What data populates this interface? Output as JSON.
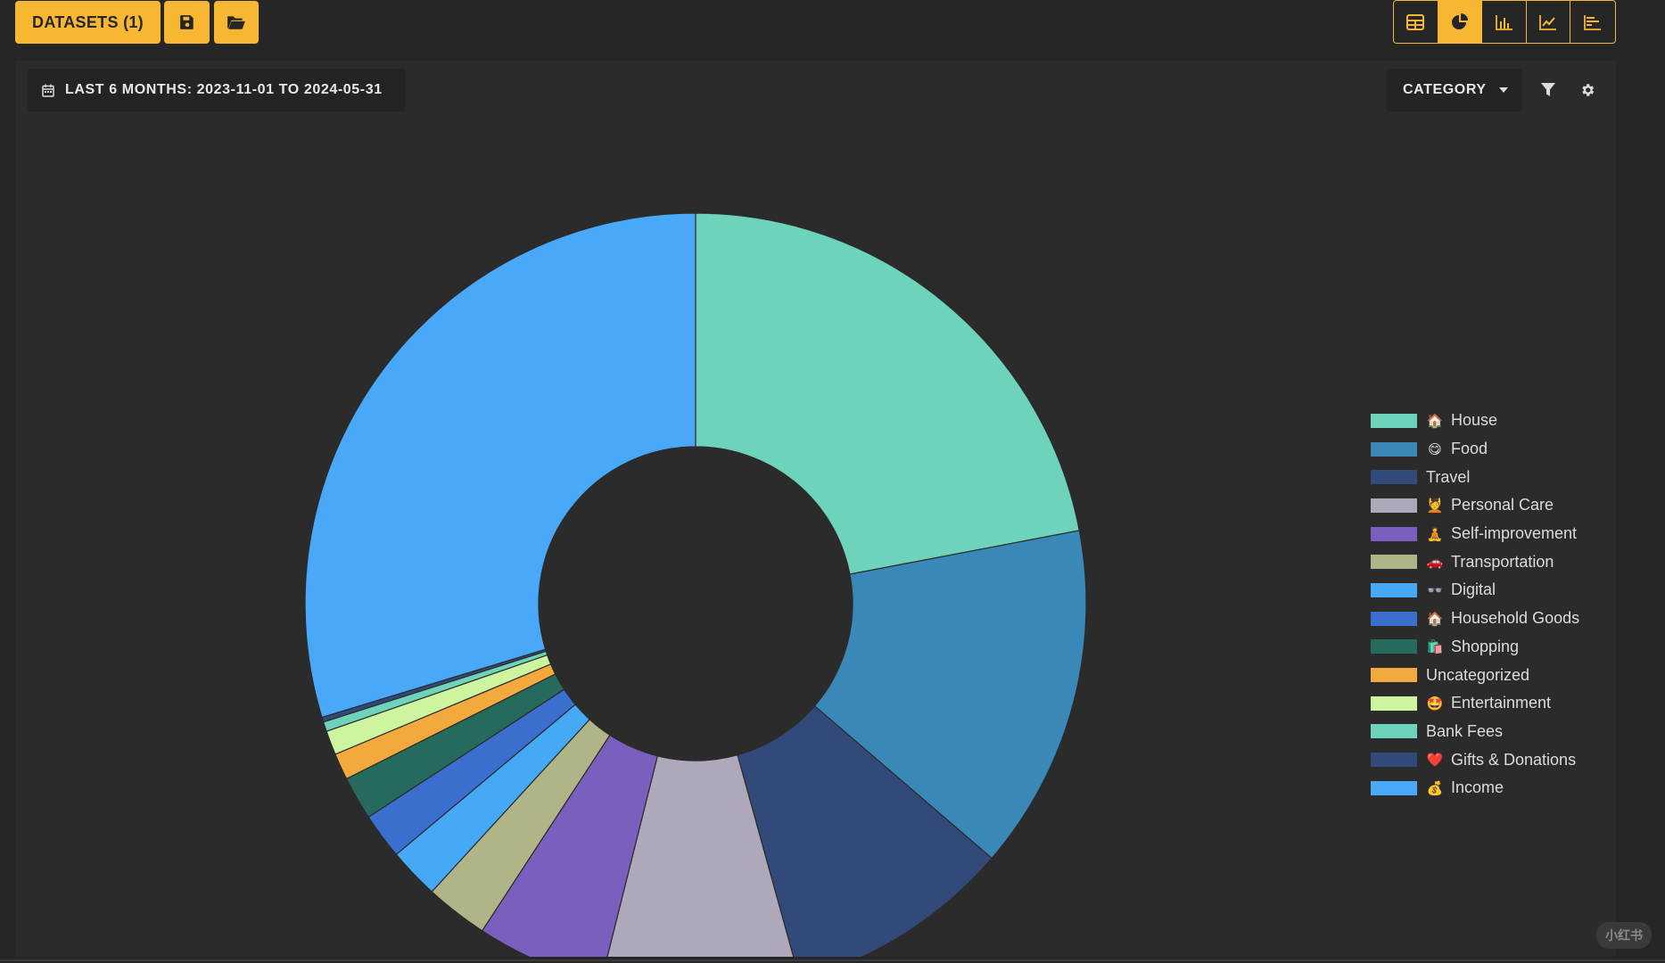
{
  "toolbar": {
    "datasets_label": "DATASETS (1)",
    "save_icon": "save-icon",
    "open_icon": "folder-open-icon",
    "views": [
      {
        "icon": "table-icon",
        "active": false
      },
      {
        "icon": "pie-chart-icon",
        "active": true
      },
      {
        "icon": "bar-chart-icon",
        "active": false
      },
      {
        "icon": "line-chart-icon",
        "active": false
      },
      {
        "icon": "horizontal-bar-chart-icon",
        "active": false
      }
    ]
  },
  "header": {
    "date_range_label": "LAST 6 MONTHS: 2023-11-01 TO 2024-05-31",
    "group_by_label": "CATEGORY"
  },
  "watermark": "小红书",
  "colors": {
    "accent": "#f7b733",
    "background": "#262626",
    "panel": "#2b2b2b"
  },
  "chart_data": {
    "type": "pie",
    "donut": true,
    "legend_position": "right",
    "slices": [
      {
        "label": "House",
        "emoji": "🏠",
        "value": 22.0,
        "color": "#6dd3ba"
      },
      {
        "label": "Food",
        "emoji": "😋",
        "value": 14.3,
        "color": "#3a88b8"
      },
      {
        "label": "Travel",
        "emoji": "",
        "value": 9.4,
        "color": "#324a7a"
      },
      {
        "label": "Personal Care",
        "emoji": "💆",
        "value": 8.2,
        "color": "#afa8bb"
      },
      {
        "label": "Self-improvement",
        "emoji": "🧘",
        "value": 5.3,
        "color": "#7b5fbe"
      },
      {
        "label": "Transportation",
        "emoji": "🚗",
        "value": 2.6,
        "color": "#b0b588"
      },
      {
        "label": "Digital",
        "emoji": "👓",
        "value": 2.1,
        "color": "#45a9f5"
      },
      {
        "label": "Household Goods",
        "emoji": "🏠",
        "value": 1.9,
        "color": "#3b6fcf"
      },
      {
        "label": "Shopping",
        "emoji": "🛍️",
        "value": 1.8,
        "color": "#256a5c"
      },
      {
        "label": "Uncategorized",
        "emoji": "",
        "value": 1.1,
        "color": "#f4a93c"
      },
      {
        "label": "Entertainment",
        "emoji": "🤩",
        "value": 1.0,
        "color": "#cdf5a0"
      },
      {
        "label": "Bank Fees",
        "emoji": "",
        "value": 0.4,
        "color": "#6dd3ba"
      },
      {
        "label": "Gifts & Donations",
        "emoji": "❤️",
        "value": 0.2,
        "color": "#324a7a"
      },
      {
        "label": "Income",
        "emoji": "💰",
        "value": 29.7,
        "color": "#49a8f7"
      }
    ]
  }
}
